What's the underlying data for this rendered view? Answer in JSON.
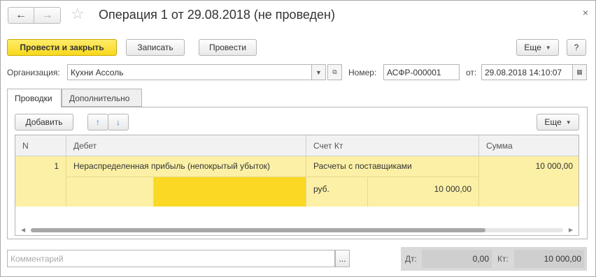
{
  "window": {
    "title": "Операция 1 от 29.08.2018 (не проведен)",
    "nav_back": "←",
    "nav_forward": "→",
    "favorite": "☆",
    "close": "×"
  },
  "toolbar": {
    "post_close": "Провести и закрыть",
    "save": "Записать",
    "post": "Провести",
    "more": "Еще",
    "help": "?"
  },
  "header": {
    "org_label": "Организация:",
    "org_value": "Кухни Ассоль",
    "number_label": "Номер:",
    "number_value": "АСФР-000001",
    "date_label": "от:",
    "date_value": "29.08.2018 14:10:07"
  },
  "tabs": [
    {
      "label": "Проводки",
      "active": true
    },
    {
      "label": "Дополнительно",
      "active": false
    }
  ],
  "table_toolbar": {
    "add": "Добавить",
    "up": "↑",
    "down": "↓",
    "more": "Еще"
  },
  "table": {
    "columns": [
      "N",
      "Дебет",
      "Счет Кт",
      "Сумма"
    ],
    "rows": [
      {
        "n": "1",
        "debit": "Нераспределенная прибыль (непокрытый убыток)",
        "credit": "Расчеты с поставщиками",
        "sum": "10 000,00",
        "credit_currency": "руб.",
        "credit_amount": "10 000,00"
      }
    ]
  },
  "footer": {
    "comment_placeholder": "Комментарий",
    "comment_btn": "...",
    "dt_label": "Дт:",
    "dt_value": "0,00",
    "kt_label": "Кт:",
    "kt_value": "10 000,00"
  }
}
